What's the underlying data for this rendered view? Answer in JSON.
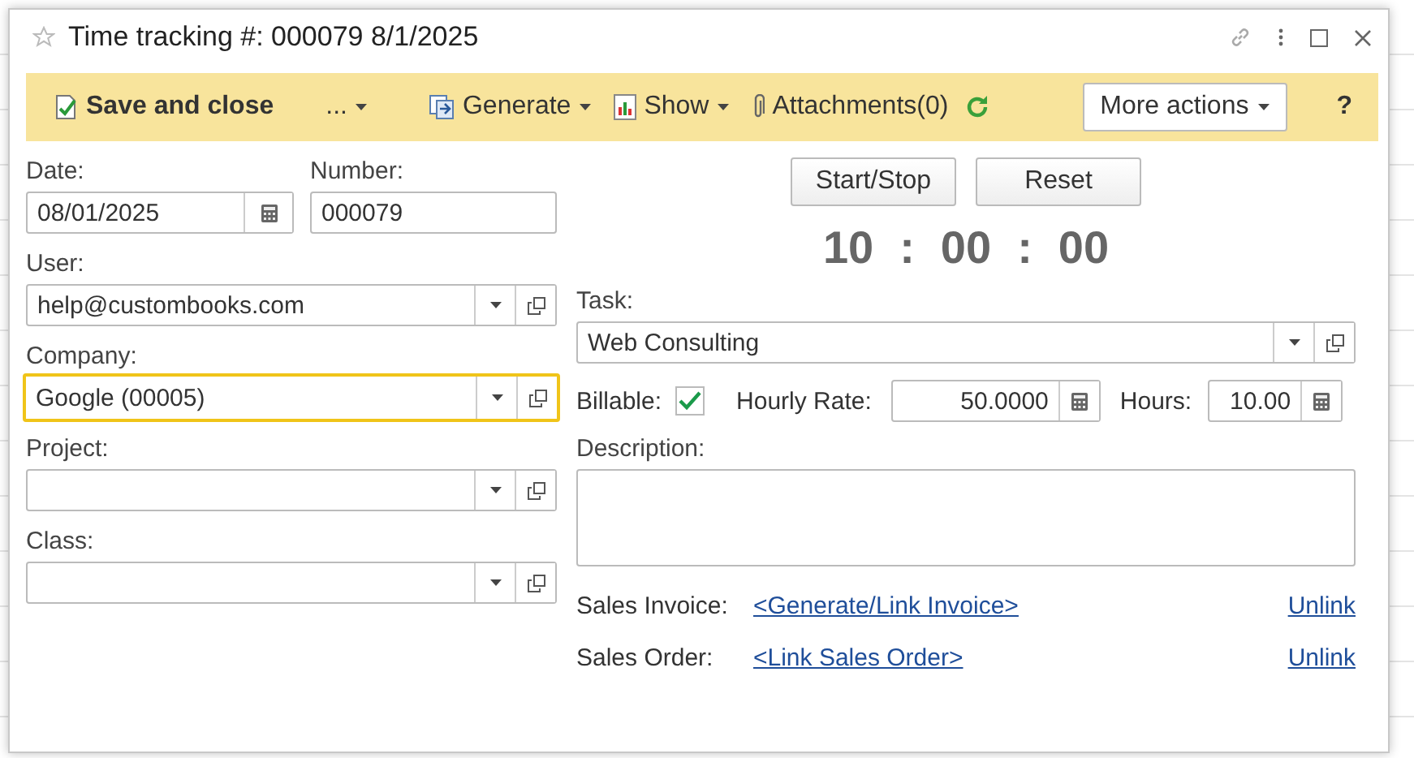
{
  "window": {
    "title": "Time tracking #: 000079 8/1/2025",
    "favorite": false
  },
  "toolbar": {
    "save": "Save and close",
    "more": "...",
    "generate": "Generate",
    "show": "Show",
    "attachments": "Attachments(0)",
    "more_actions": "More actions",
    "help": "?"
  },
  "left_fields": [
    {
      "kind": "pair",
      "items": [
        {
          "label": "Date:",
          "value": "08/01/2025",
          "kind": "date"
        },
        {
          "label": "Number:",
          "value": "000079",
          "kind": "text"
        }
      ]
    },
    {
      "kind": "lookup",
      "label": "User:",
      "value": "help@custombooks.com",
      "focused": false
    },
    {
      "kind": "lookup",
      "label": "Company:",
      "value": "Google (00005)",
      "focused": true
    },
    {
      "kind": "lookup",
      "label": "Project:",
      "focused": false
    },
    {
      "kind": "lookup",
      "label": "Class:",
      "focused": false
    }
  ],
  "timer": {
    "buttons": [
      "Start/Stop",
      "Reset"
    ],
    "parts": [
      "10",
      ":",
      "00",
      ":",
      "00"
    ]
  },
  "task": {
    "label": "Task:",
    "value": "Web Consulting"
  },
  "billable": {
    "label": "Billable:",
    "checked": true
  },
  "hourly_rate": {
    "label": "Hourly Rate:",
    "value": "50.0000"
  },
  "hours": {
    "label": "Hours:",
    "value": "10.00"
  },
  "description": {
    "label": "Description:"
  },
  "links": [
    {
      "label": "Sales Invoice:",
      "link": "<Generate/Link Invoice>",
      "unlink": "Unlink"
    },
    {
      "label": "Sales Order:",
      "link": "<Link Sales Order>",
      "unlink": "Unlink"
    }
  ]
}
